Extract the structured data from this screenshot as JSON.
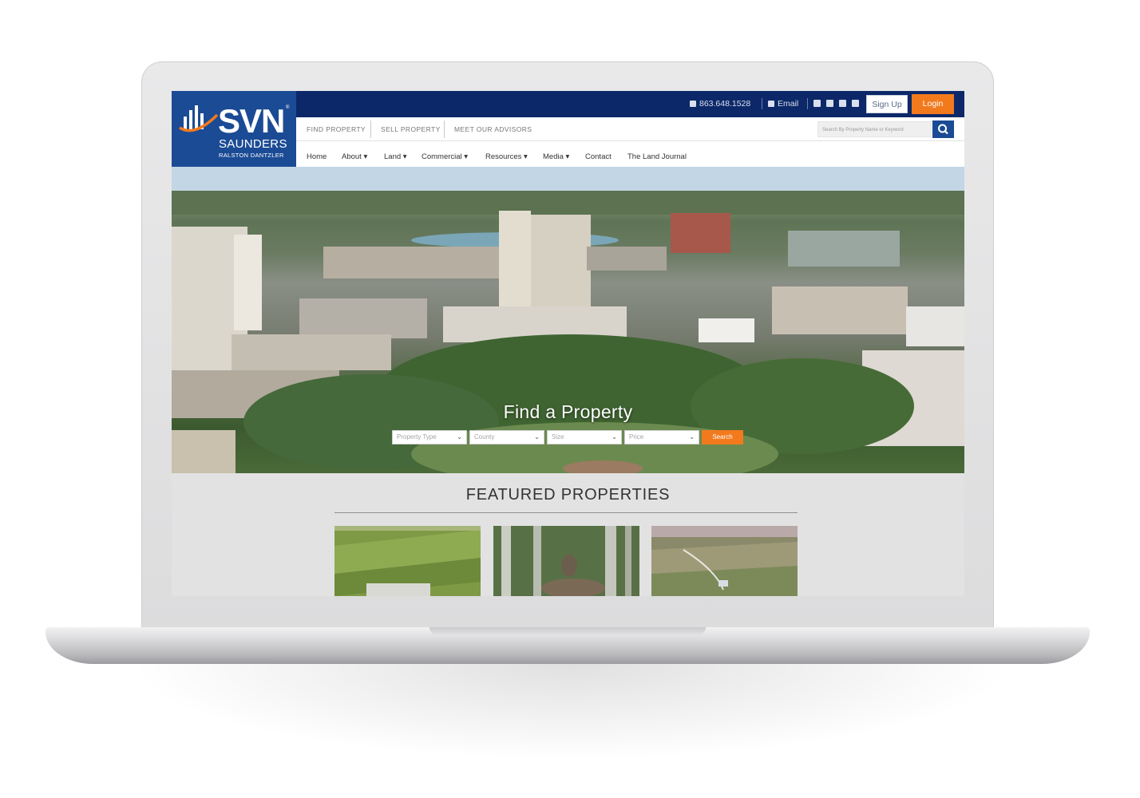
{
  "brand": {
    "logo_name": "SVN",
    "logo_tm": "®",
    "logo_line1": "SAUNDERS",
    "logo_line2": "RALSTON DANTZLER"
  },
  "topbar": {
    "phone": "863.648.1528",
    "email_label": "Email",
    "social_icons": [
      "facebook-icon",
      "twitter-icon",
      "youtube-icon",
      "linkedin-icon"
    ],
    "signup_label": "Sign Up",
    "login_label": "Login"
  },
  "subnav": {
    "items": [
      "FIND PROPERTY",
      "SELL PROPERTY",
      "MEET OUR ADVISORS"
    ],
    "search_placeholder": "Search By Property Name or Keyword"
  },
  "mainnav": {
    "items": [
      "Home",
      "About ▾",
      "Land ▾",
      "Commercial ▾",
      "Resources ▾",
      "Media ▾",
      "Contact",
      "The Land Journal"
    ]
  },
  "hero": {
    "title": "Find a Property",
    "filters": [
      "Property Type",
      "County",
      "Size",
      "Price"
    ],
    "search_label": "Search"
  },
  "featured": {
    "heading": "FEATURED PROPERTIES"
  },
  "colors": {
    "navy": "#0c2868",
    "brand_blue": "#1b4b94",
    "accent_orange": "#f27a1d"
  }
}
